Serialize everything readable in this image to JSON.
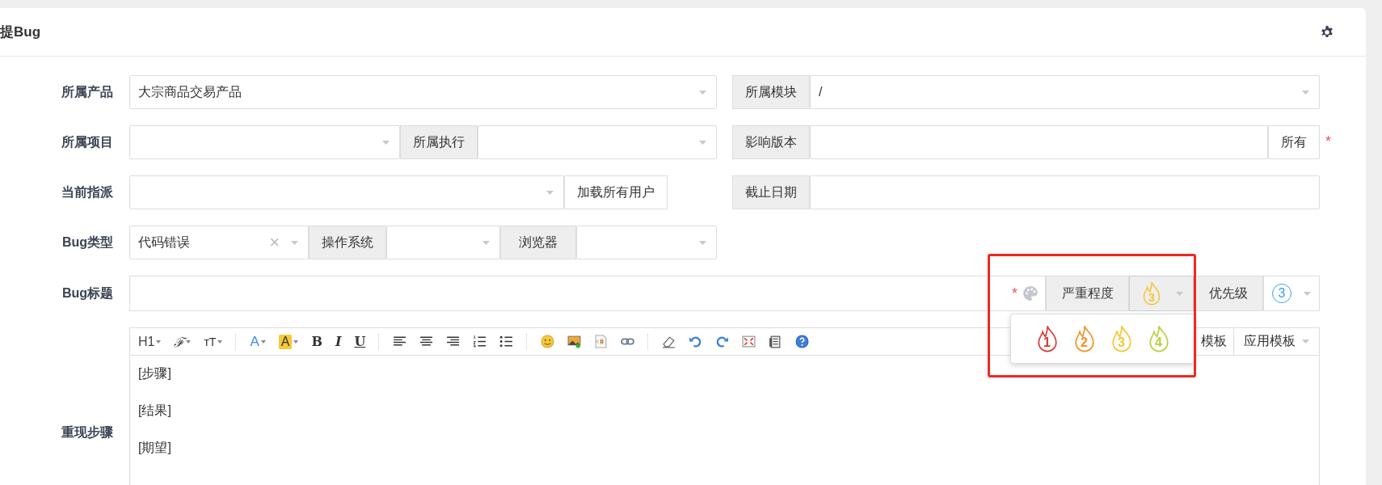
{
  "header": {
    "title": "提Bug"
  },
  "rows": [
    [
      {
        "kind": "select",
        "label": "所属产品",
        "value": "大宗商品交易产品"
      },
      {
        "kind": "group",
        "label": "所属模块",
        "parts": [
          {
            "kind": "select",
            "value": "/"
          }
        ]
      }
    ],
    [
      {
        "kind": "group",
        "label": "所属项目",
        "parts": [
          {
            "kind": "select"
          },
          {
            "kind": "addon",
            "text": "所属执行"
          },
          {
            "kind": "select"
          }
        ]
      },
      {
        "kind": "group",
        "label": "影响版本",
        "required_mark": "*",
        "parts": [
          {
            "kind": "input"
          },
          {
            "kind": "addon-plain",
            "text": "所有"
          }
        ]
      }
    ],
    [
      {
        "kind": "group",
        "label": "当前指派",
        "parts": [
          {
            "kind": "select"
          },
          {
            "kind": "button",
            "text": "加载所有用户"
          }
        ]
      },
      {
        "kind": "group",
        "label": "截止日期",
        "parts": [
          {
            "kind": "input"
          }
        ]
      }
    ],
    [
      {
        "kind": "group",
        "label": "Bug类型",
        "parts": [
          {
            "kind": "select",
            "value": "代码错误",
            "clear_mark": "×"
          },
          {
            "kind": "addon",
            "text": "操作系统"
          },
          {
            "kind": "select"
          },
          {
            "kind": "addon",
            "text": "浏览器"
          },
          {
            "kind": "select"
          }
        ]
      }
    ]
  ],
  "title_row": {
    "label": "Bug标题",
    "required_mark": "*",
    "severity_label": "严重程度",
    "severity": {
      "label": "3",
      "color": "#f6c530"
    },
    "priority_label": "优先级",
    "priority": "3",
    "severity_menu": [
      {
        "label": "1",
        "color": "#d53a35"
      },
      {
        "label": "2",
        "color": "#f39222"
      },
      {
        "label": "3",
        "color": "#f6c530"
      },
      {
        "label": "4",
        "color": "#b5d13b"
      }
    ]
  },
  "highlight_box": true,
  "steps": {
    "label": "重现步骤",
    "toolbar": [
      [
        {
          "kind": "text",
          "label": "H1",
          "caret": true
        },
        {
          "kind": "text",
          "label": "ℱ",
          "caret": true
        },
        {
          "kind": "text",
          "label": "ᴛT",
          "caret": true
        }
      ],
      [
        {
          "kind": "text",
          "label": "A",
          "caret": true
        },
        {
          "kind": "text",
          "label": "A",
          "caret": true
        },
        {
          "kind": "text",
          "label": "B"
        },
        {
          "kind": "text",
          "label": "I"
        },
        {
          "kind": "text",
          "label": "U"
        }
      ],
      [
        {
          "kind": "icon"
        },
        {
          "kind": "icon"
        },
        {
          "kind": "icon"
        },
        {
          "kind": "icon"
        },
        {
          "kind": "icon"
        }
      ],
      [
        {
          "kind": "icon"
        },
        {
          "kind": "icon"
        },
        {
          "kind": "icon"
        },
        {
          "kind": "icon"
        }
      ],
      [
        {
          "kind": "icon"
        },
        {
          "kind": "icon"
        },
        {
          "kind": "icon"
        },
        {
          "kind": "icon"
        },
        {
          "kind": "icon"
        },
        {
          "kind": "icon"
        }
      ]
    ],
    "template_buttons": [
      {
        "text": "模板",
        "caret": false
      },
      {
        "text": "应用模板",
        "caret": true
      }
    ],
    "content": [
      "[步骤]",
      "[结果]",
      "[期望]"
    ]
  }
}
